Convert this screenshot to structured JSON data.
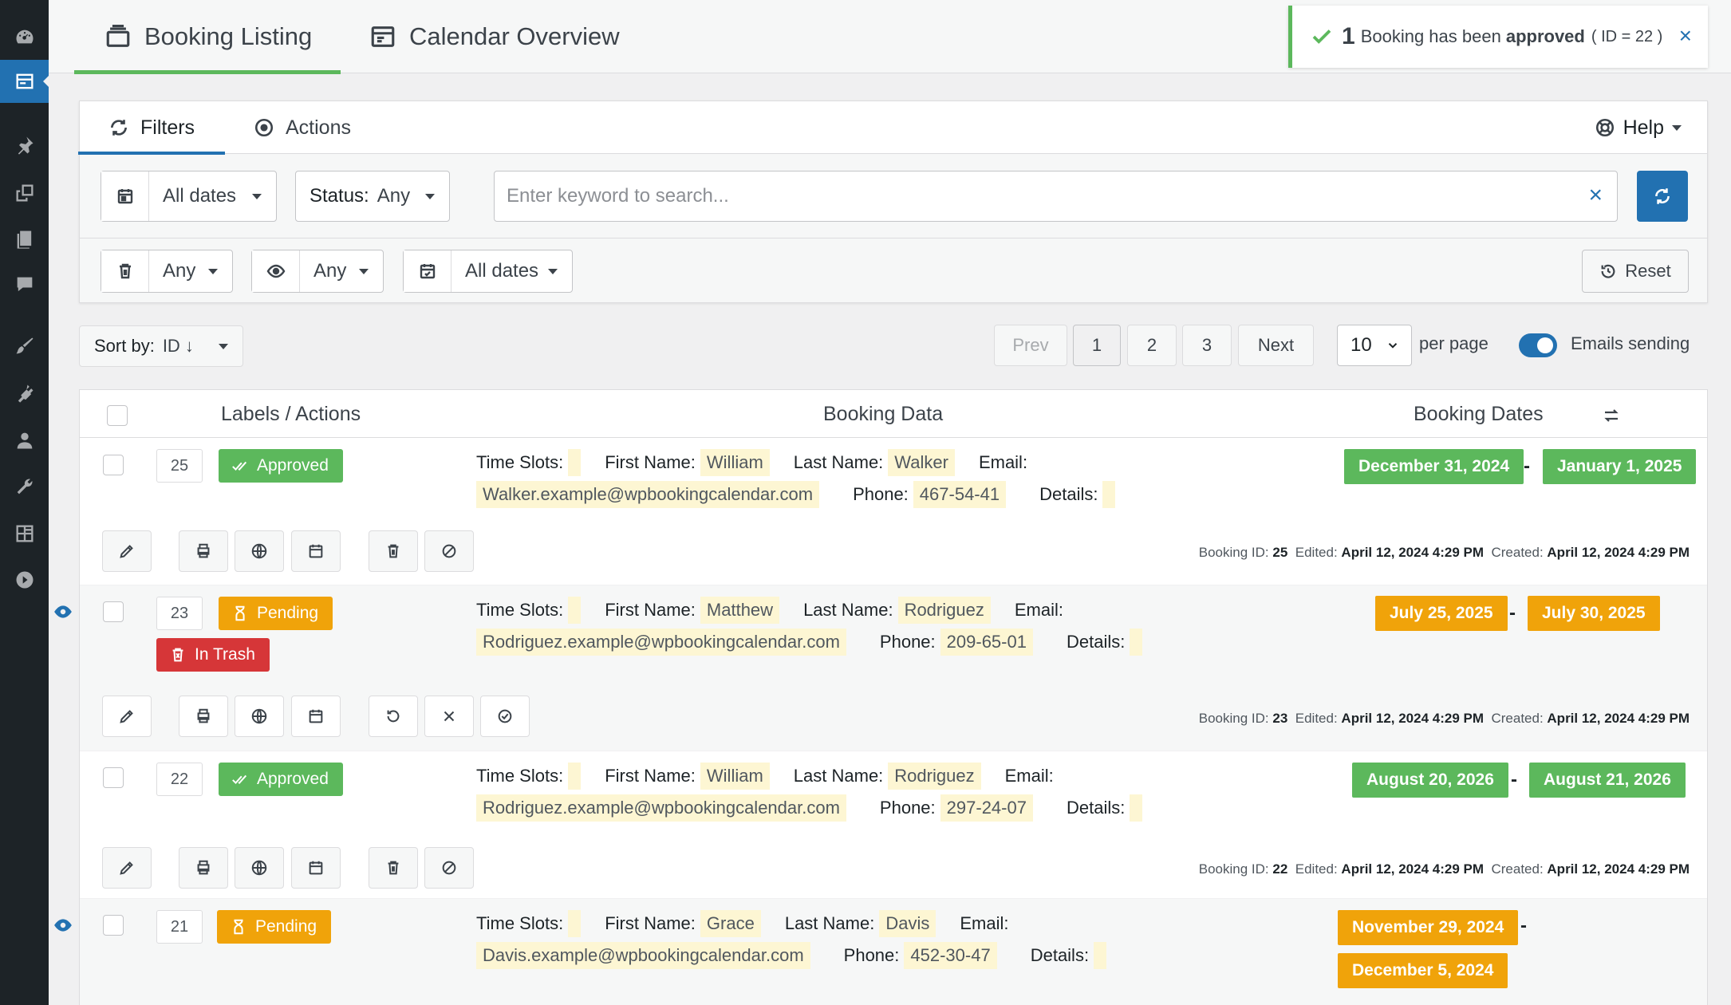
{
  "top_tabs": [
    {
      "label": "Booking Listing",
      "icon": "booking-list-icon"
    },
    {
      "label": "Calendar Overview",
      "icon": "calendar-overview-icon"
    }
  ],
  "notice": {
    "count": "1",
    "pre": "Booking has been",
    "strong": "approved",
    "id_text": "( ID = 22 )",
    "close": "×"
  },
  "panel": {
    "tabs": [
      {
        "label": "Filters"
      },
      {
        "label": "Actions"
      }
    ],
    "help": "Help",
    "dates_filter": "All dates",
    "status_label": "Status:",
    "status_value": "Any",
    "search_placeholder": "Enter keyword to search...",
    "trash_filter": "Any",
    "read_filter": "Any",
    "created_filter": "All dates",
    "reset": "Reset"
  },
  "sort": {
    "label": "Sort by:",
    "value": "ID ↓"
  },
  "pagination": {
    "prev": "Prev",
    "pages": [
      "1",
      "2",
      "3"
    ],
    "current": "1",
    "next": "Next"
  },
  "per_page": {
    "value": "10",
    "label": "per page"
  },
  "emails": {
    "label": "Emails sending",
    "enabled": true
  },
  "table": {
    "headers": {
      "labels": "Labels / Actions",
      "data": "Booking Data",
      "dates": "Booking Dates"
    },
    "field_labels": {
      "time": "Time Slots:",
      "first": "First Name:",
      "last": "Last Name:",
      "email": "Email:",
      "phone": "Phone:",
      "details": "Details:"
    },
    "meta_labels": {
      "id": "Booking ID:",
      "edited": "Edited:",
      "created": "Created:"
    },
    "rows": [
      {
        "id": "25",
        "status": "Approved",
        "first": "William",
        "last": "Walker",
        "email": "Walker.example@wpbookingcalendar.com",
        "phone": "467-54-41",
        "date_from": "December 31, 2024",
        "date_to": "January 1, 2025",
        "edited": "April 12, 2024 4:29 PM",
        "created": "April 12, 2024 4:29 PM"
      },
      {
        "id": "23",
        "status": "Pending",
        "trash": "In Trash",
        "first": "Matthew",
        "last": "Rodriguez",
        "email": "Rodriguez.example@wpbookingcalendar.com",
        "phone": "209-65-01",
        "date_from": "July 25, 2025",
        "date_to": "July 30, 2025",
        "edited": "April 12, 2024 4:29 PM",
        "created": "April 12, 2024 4:29 PM"
      },
      {
        "id": "22",
        "status": "Approved",
        "first": "William",
        "last": "Rodriguez",
        "email": "Rodriguez.example@wpbookingcalendar.com",
        "phone": "297-24-07",
        "date_from": "August 20, 2026",
        "date_to": "August 21, 2026",
        "edited": "April 12, 2024 4:29 PM",
        "created": "April 12, 2024 4:29 PM"
      },
      {
        "id": "21",
        "status": "Pending",
        "first": "Grace",
        "last": "Davis",
        "email": "Davis.example@wpbookingcalendar.com",
        "phone": "452-30-47",
        "date_from": "November 29, 2024",
        "date_to": "December 5, 2024"
      }
    ]
  },
  "colors": {
    "approved": "#5cb85c",
    "pending": "#f0a30a",
    "trash": "#d63638",
    "accent": "#2271b1"
  }
}
